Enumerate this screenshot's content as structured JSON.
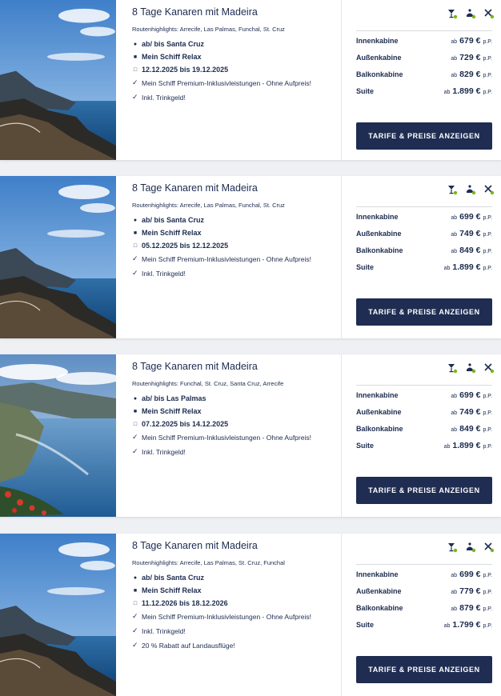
{
  "colors": {
    "navy": "#1f2d52",
    "accent_green": "#7ab51d",
    "text": "#1c2b4f"
  },
  "labels": {
    "price_prefix": "ab",
    "per_person": "p.P.",
    "button": "TARIFE & PREISE ANZEIGEN"
  },
  "amenity_icons": [
    "cocktail-icon",
    "spa-icon",
    "restaurant-icon"
  ],
  "cruises": [
    {
      "title": "8 Tage Kanaren mit Madeira",
      "route": "Routenhighlights: Arrecife, Las Palmas, Funchal, St. Cruz",
      "port": "ab/ bis Santa Cruz",
      "ship": "Mein Schiff Relax",
      "dates": "12.12.2025 bis 19.12.2025",
      "features": [
        "Mein Schiff Premium-Inklusivleistungen - Ohne Aufpreis!",
        "Inkl. Trinkgeld!"
      ],
      "image": "coast-mountains",
      "prices": [
        {
          "cabin": "Innenkabine",
          "amount": "679 €"
        },
        {
          "cabin": "Außenkabine",
          "amount": "729 €"
        },
        {
          "cabin": "Balkonkabine",
          "amount": "829 €"
        },
        {
          "cabin": "Suite",
          "amount": "1.899 €"
        }
      ]
    },
    {
      "title": "8 Tage Kanaren mit Madeira",
      "route": "Routenhighlights: Arrecife, Las Palmas, Funchal, St. Cruz",
      "port": "ab/ bis Santa Cruz",
      "ship": "Mein Schiff Relax",
      "dates": "05.12.2025 bis 12.12.2025",
      "features": [
        "Mein Schiff Premium-Inklusivleistungen - Ohne Aufpreis!",
        "Inkl. Trinkgeld!"
      ],
      "image": "coast-mountains",
      "prices": [
        {
          "cabin": "Innenkabine",
          "amount": "699 €"
        },
        {
          "cabin": "Außenkabine",
          "amount": "749 €"
        },
        {
          "cabin": "Balkonkabine",
          "amount": "849 €"
        },
        {
          "cabin": "Suite",
          "amount": "1.899 €"
        }
      ]
    },
    {
      "title": "8 Tage Kanaren mit Madeira",
      "route": "Routenhighlights: Funchal, St. Cruz, Santa Cruz, Arrecife",
      "port": "ab/ bis Las Palmas",
      "ship": "Mein Schiff Relax",
      "dates": "07.12.2025 bis 14.12.2025",
      "features": [
        "Mein Schiff Premium-Inklusivleistungen - Ohne Aufpreis!",
        "Inkl. Trinkgeld!"
      ],
      "image": "madeira-cliffs",
      "prices": [
        {
          "cabin": "Innenkabine",
          "amount": "699 €"
        },
        {
          "cabin": "Außenkabine",
          "amount": "749 €"
        },
        {
          "cabin": "Balkonkabine",
          "amount": "849 €"
        },
        {
          "cabin": "Suite",
          "amount": "1.899 €"
        }
      ]
    },
    {
      "title": "8 Tage Kanaren mit Madeira",
      "route": "Routenhighlights: Arrecife, Las Palmas, St. Cruz, Funchal",
      "port": "ab/ bis Santa Cruz",
      "ship": "Mein Schiff Relax",
      "dates": "11.12.2026 bis 18.12.2026",
      "features": [
        "Mein Schiff Premium-Inklusivleistungen - Ohne Aufpreis!",
        "Inkl. Trinkgeld!",
        "20 % Rabatt auf Landausflüge!"
      ],
      "image": "coast-mountains",
      "prices": [
        {
          "cabin": "Innenkabine",
          "amount": "699 €"
        },
        {
          "cabin": "Außenkabine",
          "amount": "779 €"
        },
        {
          "cabin": "Balkonkabine",
          "amount": "879 €"
        },
        {
          "cabin": "Suite",
          "amount": "1.799 €"
        }
      ]
    }
  ]
}
